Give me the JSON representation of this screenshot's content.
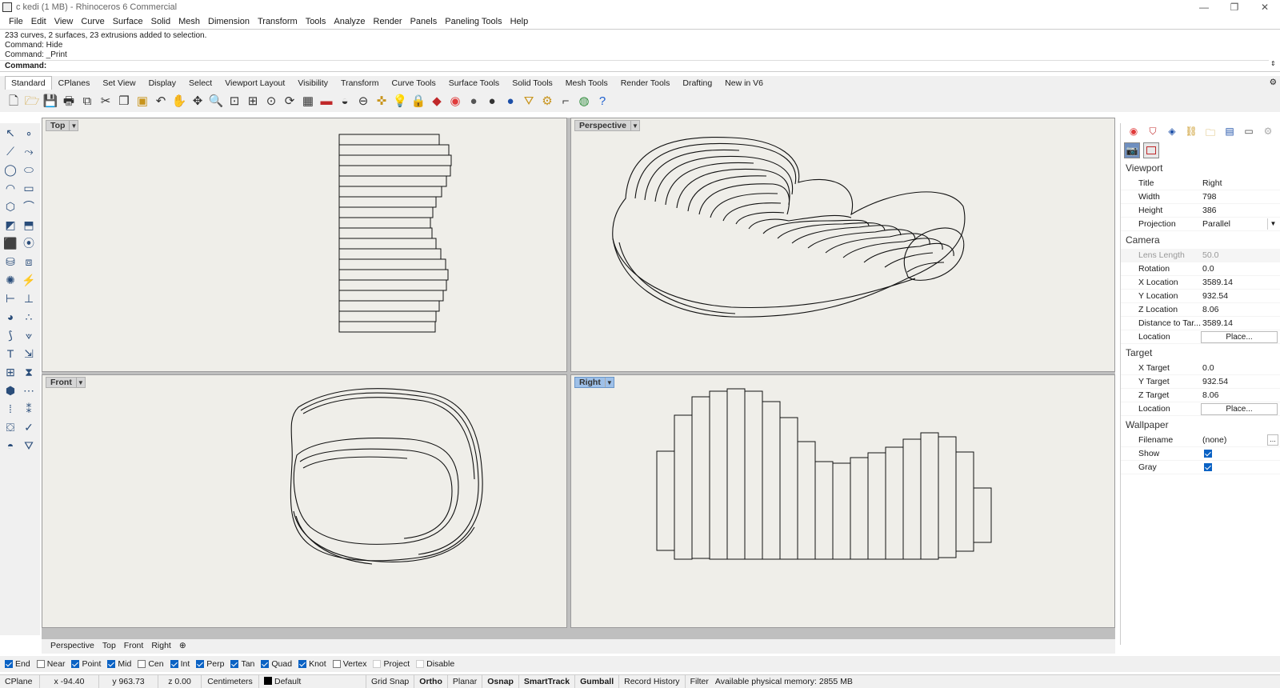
{
  "window": {
    "title": "c kedi (1 MB) - Rhinoceros 6 Commercial",
    "minimize": "—",
    "maximize": "❐",
    "close": "✕"
  },
  "menu": [
    "File",
    "Edit",
    "View",
    "Curve",
    "Surface",
    "Solid",
    "Mesh",
    "Dimension",
    "Transform",
    "Tools",
    "Analyze",
    "Render",
    "Panels",
    "Paneling Tools",
    "Help"
  ],
  "history": [
    "233 curves, 2 surfaces, 23 extrusions added to selection.",
    "Command: Hide",
    "Command: _Print"
  ],
  "command_prompt": "Command:",
  "toolbar_tabs": [
    "Standard",
    "CPlanes",
    "Set View",
    "Display",
    "Select",
    "Viewport Layout",
    "Visibility",
    "Transform",
    "Curve Tools",
    "Surface Tools",
    "Solid Tools",
    "Mesh Tools",
    "Render Tools",
    "Drafting",
    "New in V6"
  ],
  "toolbar_icons": [
    "new-icon",
    "open-icon",
    "save-icon",
    "print-icon",
    "import-icon",
    "cut-icon",
    "copy-icon",
    "paste-icon",
    "undo-icon",
    "pan-icon",
    "move-view-icon",
    "zoom-icon",
    "zoom-window-icon",
    "zoom-extents-icon",
    "zoom-selected-icon",
    "rotate-view-icon",
    "viewport-layout-icon",
    "hide-icon",
    "show-icon",
    "set-cplane-icon",
    "snap-icon",
    "light-icon",
    "lock-icon",
    "layer-icon",
    "color-icon",
    "shaded-icon",
    "render-icon",
    "material-icon",
    "filter-icon",
    "settings-icon",
    "dimension-icon",
    "globe-icon",
    "help-icon"
  ],
  "viewports": {
    "top": "Top",
    "perspective": "Perspective",
    "front": "Front",
    "right": "Right"
  },
  "viewport_tabs": [
    "Perspective",
    "Top",
    "Front",
    "Right"
  ],
  "viewport_tab_add": "⊕",
  "osnap": [
    {
      "label": "End",
      "checked": true
    },
    {
      "label": "Near",
      "checked": false
    },
    {
      "label": "Point",
      "checked": true
    },
    {
      "label": "Mid",
      "checked": true
    },
    {
      "label": "Cen",
      "checked": false
    },
    {
      "label": "Int",
      "checked": true
    },
    {
      "label": "Perp",
      "checked": true
    },
    {
      "label": "Tan",
      "checked": true
    },
    {
      "label": "Quad",
      "checked": true
    },
    {
      "label": "Knot",
      "checked": true
    },
    {
      "label": "Vertex",
      "checked": false
    },
    {
      "label": "Project",
      "checked": false
    },
    {
      "label": "Disable",
      "checked": false
    }
  ],
  "status": {
    "cplane": "CPlane",
    "x": "x -94.40",
    "y": "y 963.73",
    "z": "z 0.00",
    "units": "Centimeters",
    "layer": "Default",
    "grid_snap": "Grid Snap",
    "ortho": "Ortho",
    "planar": "Planar",
    "osnap": "Osnap",
    "smarttrack": "SmartTrack",
    "gumball": "Gumball",
    "record_history": "Record History",
    "filter": "Filter",
    "memory": "Available physical memory: 2855 MB"
  },
  "panel": {
    "viewport_section": "Viewport",
    "title_label": "Title",
    "title_value": "Right",
    "width_label": "Width",
    "width_value": "798",
    "height_label": "Height",
    "height_value": "386",
    "projection_label": "Projection",
    "projection_value": "Parallel",
    "camera_section": "Camera",
    "lens_label": "Lens Length",
    "lens_value": "50.0",
    "rotation_label": "Rotation",
    "rotation_value": "0.0",
    "xloc_label": "X Location",
    "xloc_value": "3589.14",
    "yloc_label": "Y Location",
    "yloc_value": "932.54",
    "zloc_label": "Z Location",
    "zloc_value": "8.06",
    "dist_label": "Distance to Tar...",
    "dist_value": "3589.14",
    "location_label": "Location",
    "place_button": "Place...",
    "target_section": "Target",
    "xt_label": "X Target",
    "xt_value": "0.0",
    "yt_label": "Y Target",
    "yt_value": "932.54",
    "zt_label": "Z Target",
    "zt_value": "8.06",
    "tlocation_label": "Location",
    "wallpaper_section": "Wallpaper",
    "filename_label": "Filename",
    "filename_value": "(none)",
    "browse": "...",
    "show_label": "Show",
    "gray_label": "Gray"
  }
}
